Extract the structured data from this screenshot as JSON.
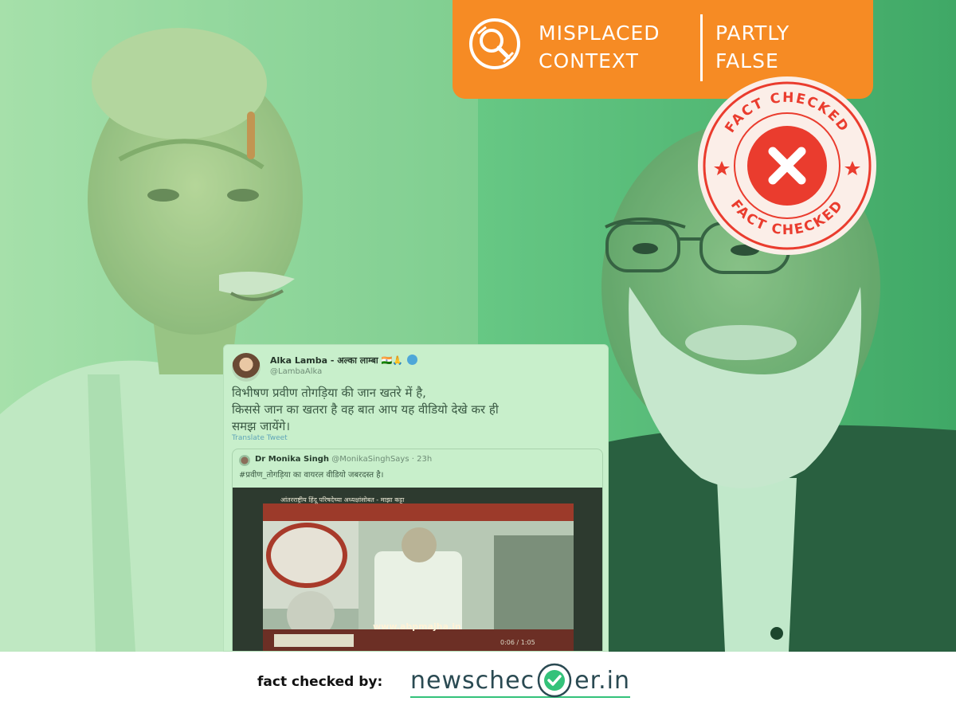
{
  "verdict": {
    "label_left_line1": "MISPLACED",
    "label_left_line2": "CONTEXT",
    "label_right_line1": "PARTLY",
    "label_right_line2": "FALSE",
    "banner_color": "#f68b24"
  },
  "stamp": {
    "top_text": "FACT CHECKED",
    "bottom_text": "FACT CHECKED",
    "icon": "cross-icon",
    "color": "#ea3c2e"
  },
  "tweet": {
    "author_name": "Alka Lamba - अल्का लाम्बा 🇮🇳🙏",
    "author_handle": "@LambaAlka",
    "text_line1": "विभीषण प्रवीण तोगड़िया की जान खतरे में है,",
    "text_line2": "किससे जान का खतरा है वह बात आप यह वीडियो देखे कर ही",
    "text_line3": "समझ जायेंगे।",
    "translate_label": "Translate Tweet",
    "quote": {
      "author_name": "Dr Monika Singh",
      "author_handle": "@MonikaSinghSays",
      "time": "· 23h",
      "text": "#प्रवीण_तोगड़िया का वायरल वीडियो जबरदस्त है।",
      "video_ticker": "आंतरराष्ट्रीय हिंदू परिषदेच्या अध्यक्षांसोबत - माझा कट्टा",
      "video_url": "www.abpmajha.in",
      "video_time": "0:06 / 1:05"
    }
  },
  "footer": {
    "prefix": "fact checked by:",
    "brand_left": "newschec",
    "brand_right": "er.in",
    "brand_color": "#2a4a52",
    "accent_color": "#34c27a"
  }
}
